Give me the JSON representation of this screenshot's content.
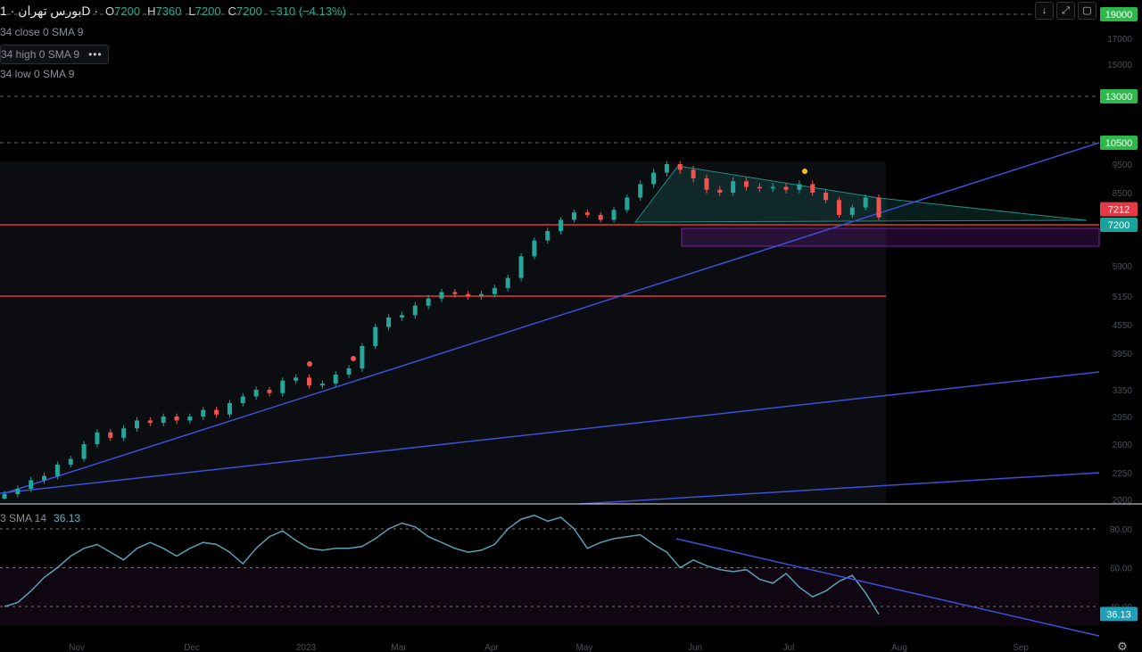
{
  "header": {
    "symbol": "بورس تهران · 1D ·",
    "o_label": "O",
    "o_value": "7200",
    "h_label": "H",
    "h_value": "7360",
    "l_label": "L",
    "l_value": "7200",
    "c_label": "C",
    "c_value": "7200",
    "change": "−310 (−4.13%)"
  },
  "indicators": {
    "close_sma": "34 close 0 SMA 9",
    "high_sma": "34 high 0 SMA 9",
    "high_menu": "•••",
    "low_sma": "34 low 0 SMA 9"
  },
  "toolbar": {
    "download_icon": "↓",
    "expand_icon": "⤢",
    "window_icon": "▢"
  },
  "rsi": {
    "label": "3 SMA 14",
    "value": "36.13"
  },
  "settings_icon": "⚙",
  "colors": {
    "up": "#26a69a",
    "down": "#ef5350",
    "trend": "#3d4fd6",
    "support": "#e53935",
    "zone": "#7b1fa2",
    "rsi_line": "#5b9fb5",
    "level_tag": "#2eb84b",
    "price_tag": "#e53945",
    "close_tag": "#1aa39a"
  },
  "chart_data": {
    "type": "candlestick",
    "timeframe": "1D",
    "price_axis_ticks": [
      19000,
      17000,
      15000,
      13000,
      10500,
      9500,
      8500,
      7200,
      5900,
      5150,
      4550,
      3950,
      3350,
      2950,
      2600,
      2250,
      2000
    ],
    "time_axis_ticks": [
      "Nov",
      "Dec",
      "2023",
      "Mar",
      "Apr",
      "May",
      "Jun",
      "Jul",
      "Aug",
      "Sep"
    ],
    "labeled_levels": [
      19000,
      13000,
      10500
    ],
    "current_price": 7212,
    "close": 7200,
    "support_lines": [
      7200,
      5150
    ],
    "last": {
      "open": 7510,
      "high": 7360,
      "low": 7200,
      "close": 7200,
      "change": -310,
      "change_pct": -4.13
    },
    "price_path": [
      2050,
      2100,
      2180,
      2220,
      2350,
      2420,
      2600,
      2750,
      2680,
      2800,
      2900,
      2870,
      2950,
      2900,
      2950,
      3050,
      2980,
      3150,
      3250,
      3350,
      3300,
      3500,
      3550,
      3420,
      3450,
      3600,
      3700,
      4100,
      4500,
      4700,
      4750,
      4950,
      5100,
      5250,
      5200,
      5150,
      5200,
      5350,
      5600,
      6200,
      6700,
      7000,
      7400,
      7700,
      7600,
      7400,
      7800,
      8300,
      8800,
      9200,
      9500,
      9300,
      9000,
      8600,
      8500,
      8900,
      8700,
      8650,
      8700,
      8600,
      8800,
      8500,
      8200,
      7600,
      7900,
      8300,
      7500
    ],
    "rsi": {
      "name": "RSI SMA 14",
      "levels": [
        80,
        60,
        40
      ],
      "value": 36.13,
      "path": [
        40,
        42,
        48,
        55,
        60,
        66,
        70,
        72,
        68,
        64,
        70,
        73,
        70,
        66,
        70,
        73,
        72,
        68,
        62,
        70,
        76,
        79,
        74,
        70,
        69,
        70,
        70,
        71,
        75,
        80,
        83,
        81,
        76,
        73,
        70,
        68,
        69,
        72,
        80,
        85,
        87,
        84,
        86,
        80,
        70,
        73,
        75,
        76,
        77,
        72,
        68,
        60,
        64,
        61,
        59,
        58,
        59,
        54,
        52,
        57,
        50,
        45,
        48,
        53,
        56,
        47,
        36
      ]
    }
  }
}
